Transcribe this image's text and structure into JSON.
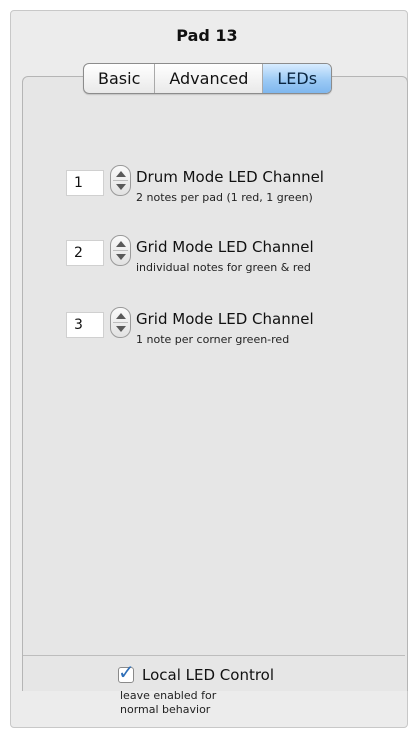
{
  "title": "Pad 13",
  "tabs": [
    {
      "label": "Basic",
      "active": false
    },
    {
      "label": "Advanced",
      "active": false
    },
    {
      "label": "LEDs",
      "active": true
    }
  ],
  "channels": [
    {
      "value": "1",
      "label": "Drum Mode LED Channel",
      "description": "2 notes per pad (1 red, 1 green)"
    },
    {
      "value": "2",
      "label": "Grid Mode LED Channel",
      "description": "individual notes for green & red"
    },
    {
      "value": "3",
      "label": "Grid Mode LED Channel",
      "description": "1 note per corner green-red"
    }
  ],
  "local_led": {
    "checked": true,
    "label": "Local LED Control",
    "description_line1": "leave enabled for",
    "description_line2": "normal behavior"
  },
  "colors": {
    "active_tab": "#8ec0f0",
    "checkmark": "#2f6fb8",
    "panel_bg": "#ececec"
  }
}
